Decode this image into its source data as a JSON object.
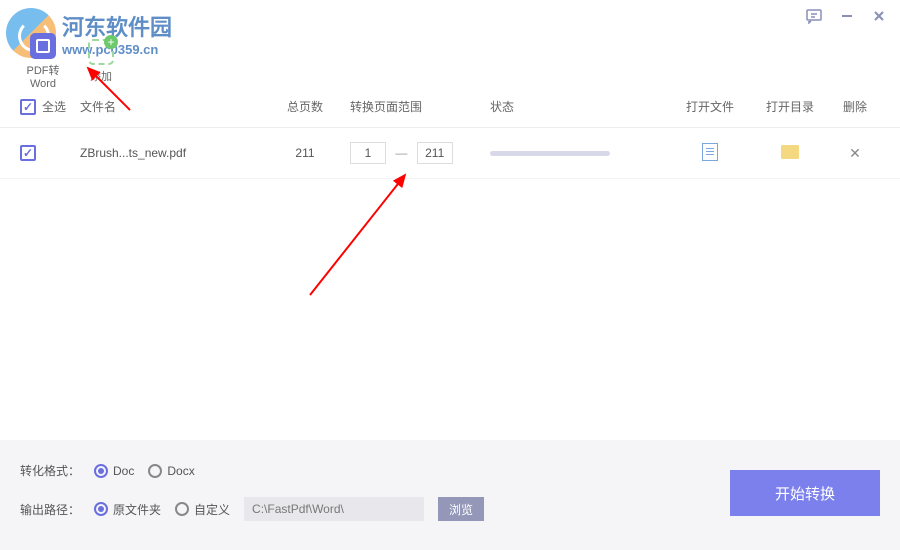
{
  "window": {
    "feedback_icon": "feedback",
    "minimize_icon": "minimize",
    "close_icon": "close"
  },
  "toolbar": {
    "mode": {
      "label": "PDF转Word",
      "icon": "app"
    },
    "add": {
      "label": "添加",
      "icon": "add"
    }
  },
  "columns": {
    "select_all": "全选",
    "filename": "文件名",
    "total_pages": "总页数",
    "page_range": "转换页面范围",
    "status": "状态",
    "open_file": "打开文件",
    "open_dir": "打开目录",
    "delete": "删除"
  },
  "rows": [
    {
      "checked": true,
      "filename": "ZBrush...ts_new.pdf",
      "total_pages": "211",
      "range_from": "1",
      "range_sep": "—",
      "range_to": "211"
    }
  ],
  "footer": {
    "format_label": "转化格式：",
    "format_options": [
      {
        "label": "Doc",
        "selected": true
      },
      {
        "label": "Docx",
        "selected": false
      }
    ],
    "output_label": "输出路径：",
    "output_options": [
      {
        "label": "原文件夹",
        "selected": true
      },
      {
        "label": "自定义",
        "selected": false
      }
    ],
    "output_path": "C:\\FastPdf\\Word\\",
    "browse": "浏览",
    "start": "开始转换"
  },
  "watermark": {
    "title": "河东软件园",
    "url": "www.pc0359.cn"
  }
}
